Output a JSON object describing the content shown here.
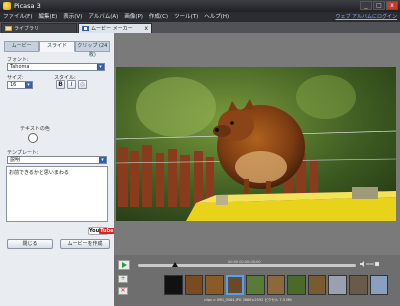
{
  "window": {
    "title": "Picasa 3",
    "controls": [
      "_",
      "□",
      "x"
    ]
  },
  "menu": {
    "items": [
      "ファイル(F)",
      "編集(E)",
      "表示(V)",
      "アルバム(A)",
      "画像(P)",
      "作成(C)",
      "ツール(T)",
      "ヘルプ(H)"
    ],
    "sign_in": "ウェブ アルバムにログイン"
  },
  "tabs": {
    "library": "ライブラリ",
    "movie_maker": "ムービー メーカー",
    "close": "x"
  },
  "left_panel": {
    "subtabs": [
      "ムービー",
      "スライド",
      "クリップ (24 枚)"
    ],
    "font_label": "フォント:",
    "font_value": "Tahoma",
    "size_label": "サイズ:",
    "size_value": "16",
    "style_label": "スタイル:",
    "bold": "B",
    "italic": "I",
    "style_extra": "◎",
    "text_color_label": "テキストの色",
    "template_label": "テンプレート:",
    "template_value": "説明",
    "text_value": "お前できるかと思いまわる",
    "youtube": {
      "you": "You",
      "tube": "Tube"
    },
    "close_button": "閉じる",
    "create_button": "ムービーを作成"
  },
  "player": {
    "time": "00:00 00:00:00:00",
    "status_text": "clips > IMG_0064.JPG     3888×2592 ピクセル     7.5 MB"
  },
  "colors": {
    "accent": "#2f5fb7",
    "titlebar": "#2a2c31",
    "panel": "#e9ecf1",
    "youtube_red": "#dd2222"
  },
  "icons": [
    "picasa-icon",
    "library-icon",
    "movie-icon",
    "play-icon",
    "add-icon",
    "delete-icon",
    "volume-icon"
  ]
}
